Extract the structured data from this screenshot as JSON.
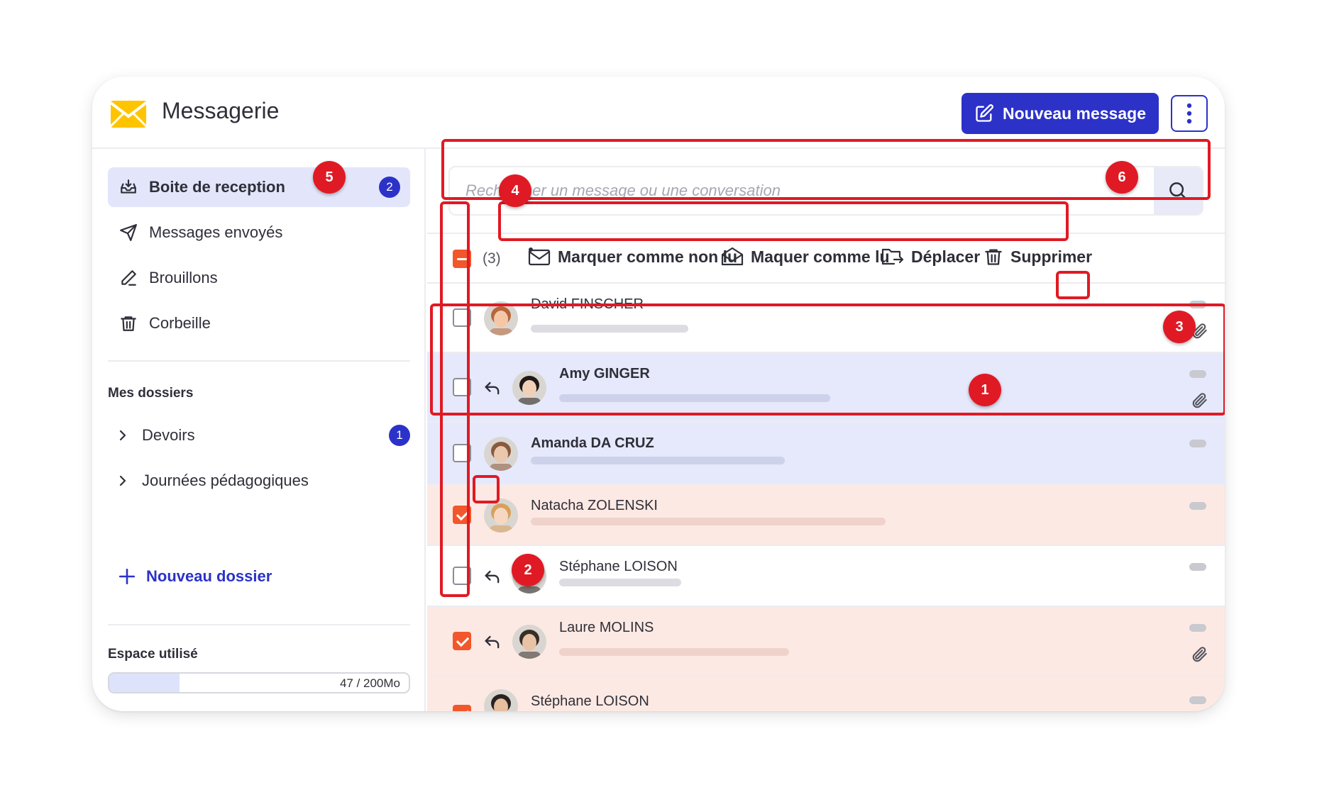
{
  "header": {
    "title": "Messagerie",
    "new_message_label": "Nouveau message"
  },
  "sidebar": {
    "items": [
      {
        "label": "Boite de reception",
        "badge": "2",
        "icon": "inbox-icon"
      },
      {
        "label": "Messages envoyés",
        "icon": "send-icon"
      },
      {
        "label": "Brouillons",
        "icon": "pencil-icon"
      },
      {
        "label": "Corbeille",
        "icon": "trash-icon"
      }
    ],
    "folders_title": "Mes dossiers",
    "folders": [
      {
        "label": "Devoirs",
        "badge": "1"
      },
      {
        "label": "Journées pédagogiques"
      }
    ],
    "new_folder_label": "Nouveau dossier",
    "storage_title": "Espace utilisé",
    "storage_text": "47 / 200Mo",
    "storage_fraction": 0.235
  },
  "search": {
    "placeholder": "Rechercher un message ou une conversation"
  },
  "toolbar": {
    "count": "(3)",
    "mark_unread": "Marquer comme non lu",
    "mark_read": "Maquer comme lu",
    "move": "Déplacer",
    "delete": "Supprimer"
  },
  "messages": [
    {
      "sender": "David FINSCHER",
      "checked": false,
      "reply": false,
      "attachment": true,
      "unread": false,
      "style": "white"
    },
    {
      "sender": "Amy GINGER",
      "checked": false,
      "reply": true,
      "attachment": true,
      "unread": true,
      "style": "blue"
    },
    {
      "sender": "Amanda DA CRUZ",
      "checked": false,
      "reply": false,
      "attachment": false,
      "unread": true,
      "style": "blue"
    },
    {
      "sender": "Natacha ZOLENSKI",
      "checked": true,
      "reply": false,
      "attachment": false,
      "unread": false,
      "style": "peach"
    },
    {
      "sender": "Stéphane LOISON",
      "checked": false,
      "reply": true,
      "attachment": false,
      "unread": false,
      "style": "white"
    },
    {
      "sender": "Laure MOLINS",
      "checked": true,
      "reply": true,
      "attachment": true,
      "unread": false,
      "style": "peach"
    },
    {
      "sender": "Stéphane LOISON",
      "checked": true,
      "reply": false,
      "attachment": false,
      "unread": false,
      "style": "peach"
    }
  ],
  "annotations": [
    "1",
    "2",
    "3",
    "4",
    "5",
    "6"
  ],
  "colors": {
    "primary": "#2c32c8",
    "accent": "#f2572b",
    "annotation": "#e01a24",
    "unread_row": "#e6e9fb",
    "selected_row": "#fde9e3"
  }
}
